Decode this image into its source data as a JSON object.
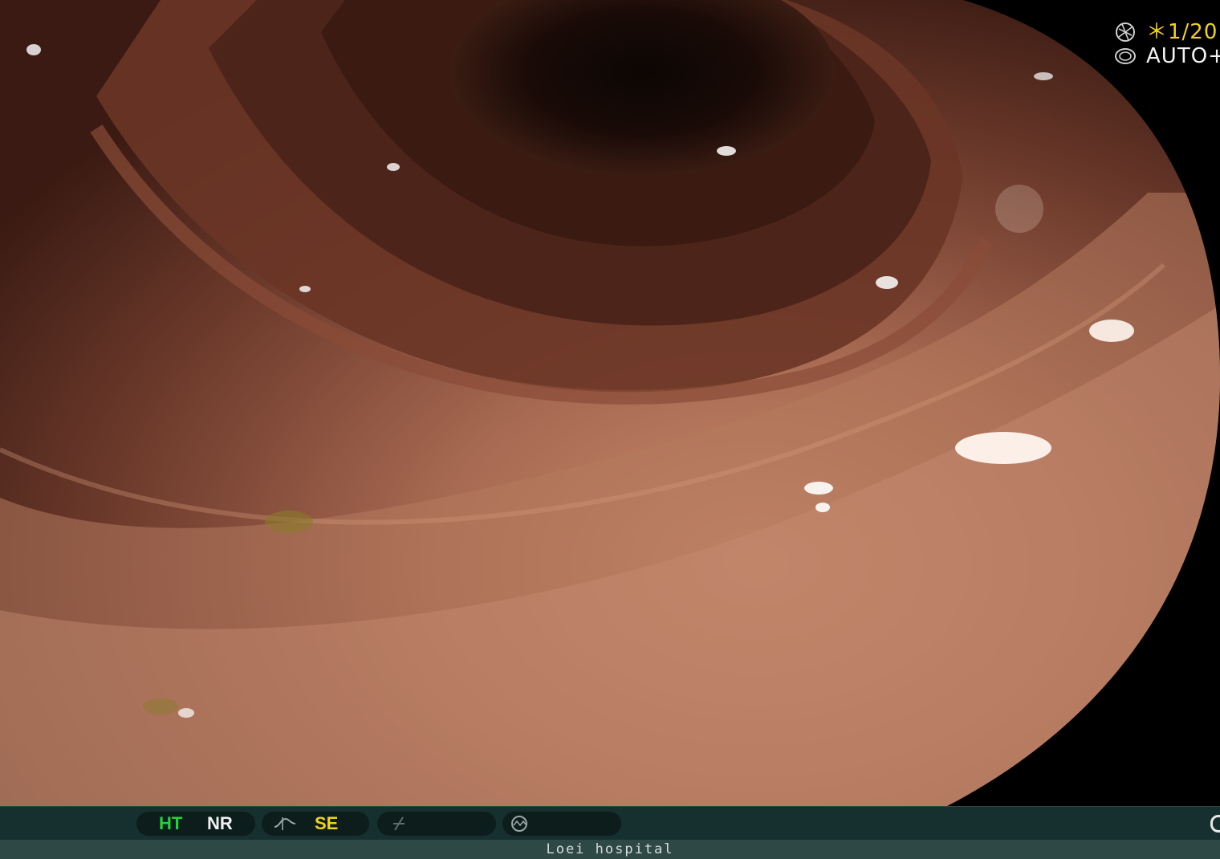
{
  "overlay": {
    "shutter_icon": "aperture-icon",
    "shutter_value": "＊1/20",
    "mode_icon": "iris-icon",
    "mode_value": "AUTO+"
  },
  "status_bar": {
    "ht_label": "HT",
    "nr_label": "NR",
    "se_label": "SE",
    "se_icon": "enhance-curve-icon",
    "fx_icon": "fx-slash-icon",
    "scope_icon": "scope-icon",
    "colors": {
      "ht": "#22d436",
      "nr": "#f0f0f0",
      "se": "#f0d31c"
    }
  },
  "footer": {
    "hospital": "Loei hospital"
  }
}
